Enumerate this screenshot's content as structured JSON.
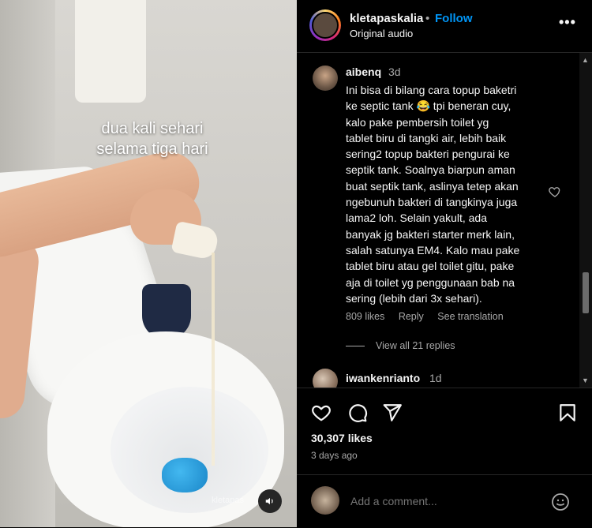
{
  "post": {
    "username": "kletapaskalia",
    "separator": "•",
    "follow_label": "Follow",
    "audio": "Original audio",
    "more_label": "•••"
  },
  "media": {
    "caption_line1": "dua kali sehari",
    "caption_line2": "selama tiga hari",
    "watermark": "kletapas",
    "mute_icon": "speaker-icon"
  },
  "comments": [
    {
      "username": "aibenq",
      "time": "3d",
      "text_lines": [
        "Ini bisa di bilang cara topup baketri",
        "ke septic tank 😂 tpi beneran cuy,",
        "kalo pake pembersih toilet yg",
        "tablet biru di tangki air, lebih baik",
        "sering2 topup bakteri pengurai ke",
        "septik tank. Soalnya biarpun aman",
        "buat septik tank, aslinya tetep akan",
        "ngebunuh bakteri di tangkinya juga",
        "lama2 loh. Selain yakult, ada",
        "banyak jg bakteri starter merk lain,",
        "salah satunya EM4. Kalo mau pake",
        "tablet biru atau gel toilet gitu, pake",
        "aja di toilet yg penggunaan bab na",
        "sering (lebih dari 3x sehari)."
      ],
      "likes": "809 likes",
      "reply_label": "Reply",
      "translate_label": "See translation",
      "view_replies": "View all 21 replies"
    },
    {
      "username": "iwankenrianto",
      "time": "1d"
    }
  ],
  "actions": {
    "likes_count": "30,307 likes",
    "posted": "3 days ago"
  },
  "composer": {
    "placeholder": "Add a comment..."
  },
  "colors": {
    "accent": "#0095f6",
    "background": "#000000",
    "secondary_text": "#a8a8a8",
    "divider": "#262626"
  }
}
